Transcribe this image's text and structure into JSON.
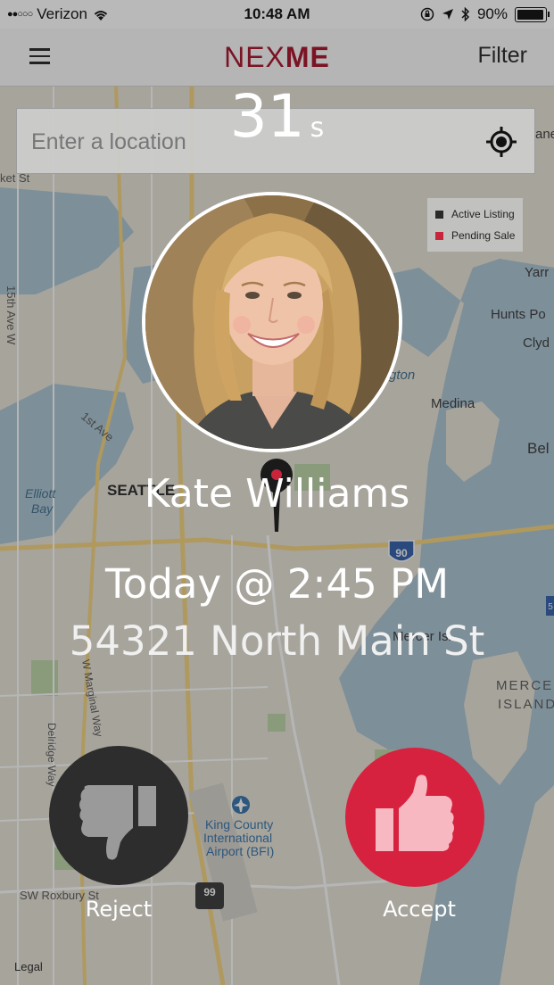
{
  "status_bar": {
    "carrier": "Verizon",
    "time": "10:48 AM",
    "battery": "90%",
    "battery_level": 0.9
  },
  "nav": {
    "logo_light": "NEX",
    "logo_bold": "ME",
    "filter_label": "Filter"
  },
  "search": {
    "placeholder": "Enter a location"
  },
  "legend": {
    "items": [
      {
        "label": "Active Listing",
        "color": "#2a2a2a"
      },
      {
        "label": "Pending Sale",
        "color": "#c8243c"
      }
    ]
  },
  "map": {
    "labels": [
      {
        "text": "ket St"
      },
      {
        "text": "15th Ave W"
      },
      {
        "text": "1st Ave"
      },
      {
        "text": "Elliott"
      },
      {
        "text": "Bay"
      },
      {
        "text": "SEATTLE"
      },
      {
        "text": "Medina"
      },
      {
        "text": "Hunts Po"
      },
      {
        "text": "Clyd"
      },
      {
        "text": "Yarr"
      },
      {
        "text": "Bel"
      },
      {
        "text": "ane"
      },
      {
        "text": "gton"
      },
      {
        "text": "Mercer Isl"
      },
      {
        "text": "MERCER"
      },
      {
        "text": "ISLAND"
      },
      {
        "text": "W Marginal Way"
      },
      {
        "text": "Delridge Way"
      },
      {
        "text": "King County"
      },
      {
        "text": "International"
      },
      {
        "text": "Airport (BFI)"
      },
      {
        "text": "SW Roxbury St"
      },
      {
        "text": "Legal"
      },
      {
        "text": "90"
      },
      {
        "text": "99"
      },
      {
        "text": "5"
      }
    ]
  },
  "countdown": {
    "value": "31",
    "unit": "s"
  },
  "request": {
    "name": "Kate Williams",
    "when": "Today @ 2:45 PM",
    "address": "54321 North Main St"
  },
  "actions": {
    "reject_label": "Reject",
    "accept_label": "Accept"
  },
  "colors": {
    "brand": "#7a1424",
    "accept": "#d6223f",
    "reject": "#2d2d2d"
  }
}
